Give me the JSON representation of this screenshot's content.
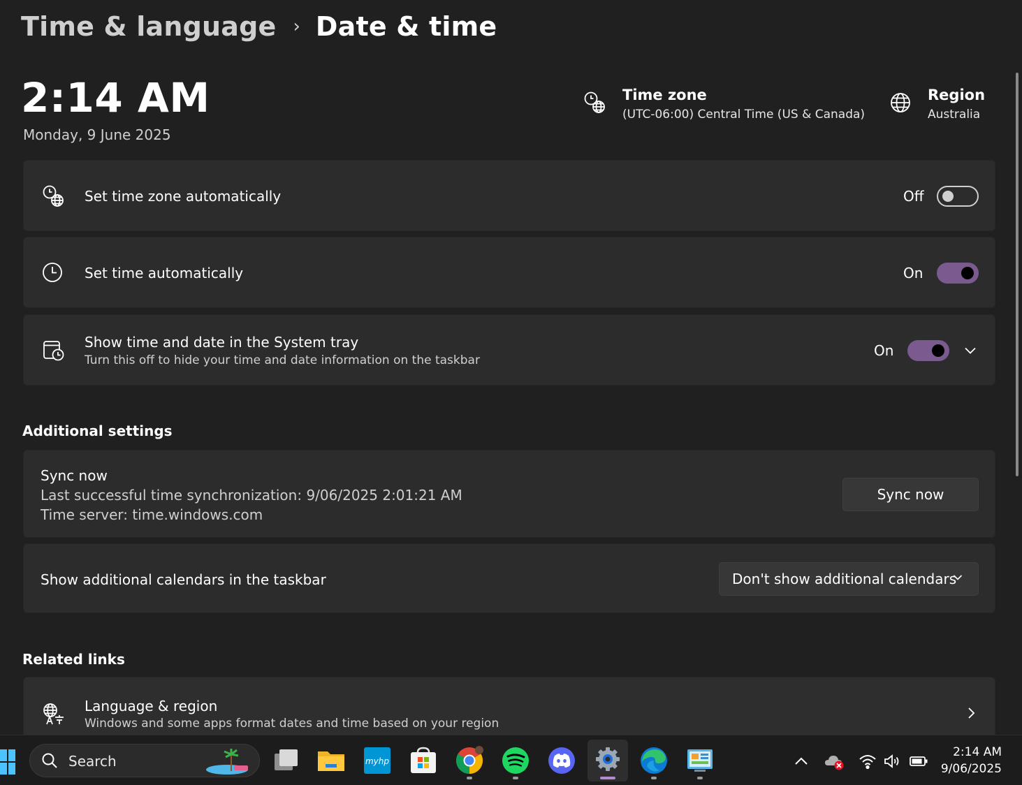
{
  "breadcrumb": {
    "parent": "Time & language",
    "separator": "›",
    "current": "Date & time"
  },
  "clock": {
    "time": "2:14 AM",
    "date": "Monday, 9 June 2025"
  },
  "time_zone": {
    "title": "Time zone",
    "value": "(UTC-06:00) Central Time (US & Canada)",
    "icon": "timezone-globe-icon"
  },
  "region": {
    "title": "Region",
    "value": "Australia",
    "icon": "globe-icon"
  },
  "settings": {
    "set_time_zone_auto": {
      "label": "Set time zone automatically",
      "state": "Off",
      "on": false,
      "icon": "timezone-globe-icon"
    },
    "set_time_auto": {
      "label": "Set time automatically",
      "state": "On",
      "on": true,
      "icon": "clock-icon"
    },
    "show_time_tray": {
      "label": "Show time and date in the System tray",
      "description": "Turn this off to hide your time and date information on the taskbar",
      "state": "On",
      "on": true,
      "icon": "calendar-clock-icon"
    }
  },
  "additional": {
    "title": "Additional settings",
    "sync": {
      "title": "Sync now",
      "last_sync": "Last successful time synchronization: 9/06/2025 2:01:21 AM",
      "server": "Time server: time.windows.com",
      "button": "Sync now"
    },
    "calendars": {
      "label": "Show additional calendars in the taskbar",
      "selected": "Don't show additional calendars"
    }
  },
  "related": {
    "title": "Related links",
    "language_region": {
      "label": "Language & region",
      "description": "Windows and some apps format dates and time based on your region",
      "icon": "language-region-icon"
    }
  },
  "taskbar": {
    "search_label": "Search",
    "apps": [
      "task-view",
      "file-explorer",
      "myhp",
      "microsoft-store",
      "chrome",
      "spotify",
      "discord",
      "settings",
      "edge",
      "control-panel"
    ],
    "tray_time": "2:14 AM",
    "tray_date": "9/06/2025"
  },
  "colors": {
    "background": "#202020",
    "card": "#2c2c2c",
    "accent": "#7b5b8f",
    "taskbar": "#1c1c1c"
  }
}
